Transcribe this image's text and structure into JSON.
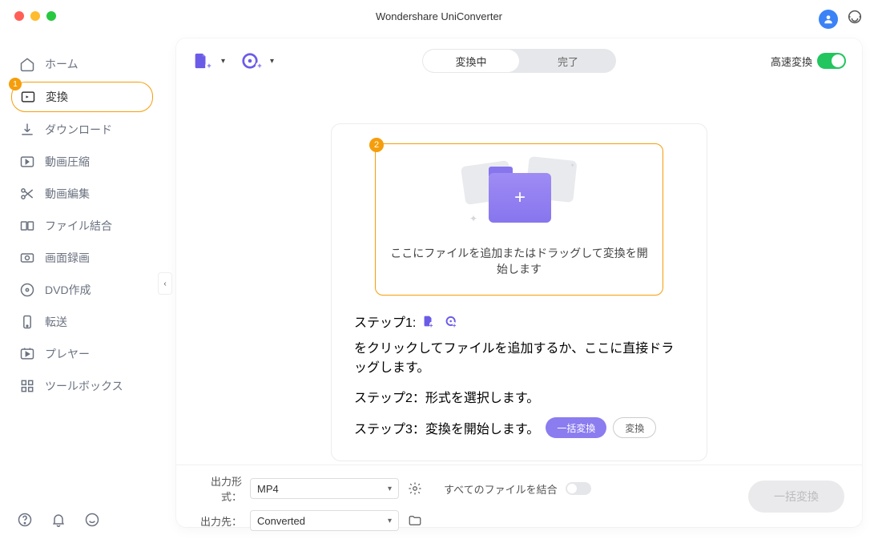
{
  "title": "Wondershare UniConverter",
  "sidebar": {
    "items": [
      {
        "label": "ホーム"
      },
      {
        "label": "変換",
        "badge": "1"
      },
      {
        "label": "ダウンロード"
      },
      {
        "label": "動画圧縮"
      },
      {
        "label": "動画編集"
      },
      {
        "label": "ファイル結合"
      },
      {
        "label": "画面録画"
      },
      {
        "label": "DVD作成"
      },
      {
        "label": "転送"
      },
      {
        "label": "プレヤー"
      },
      {
        "label": "ツールボックス"
      }
    ]
  },
  "tabs": {
    "converting": "変換中",
    "done": "完了"
  },
  "highspeed_label": "高速変換",
  "dropzone": {
    "badge": "2",
    "text": "ここにファイルを追加またはドラッグして変換を開始します"
  },
  "steps": {
    "s1a": "ステップ1:",
    "s1b": "をクリックしてファイルを追加するか、ここに直接ドラッグします。",
    "s2": "ステップ2：形式を選択します。",
    "s3": "ステップ3：変換を開始します。",
    "batch_btn": "一括変換",
    "single_btn": "変換"
  },
  "bottom": {
    "format_label": "出力形式：",
    "format_value": "MP4",
    "dest_label": "出力先：",
    "dest_value": "Converted",
    "merge_label": "すべてのファイルを結合",
    "big_btn": "一括変換"
  }
}
